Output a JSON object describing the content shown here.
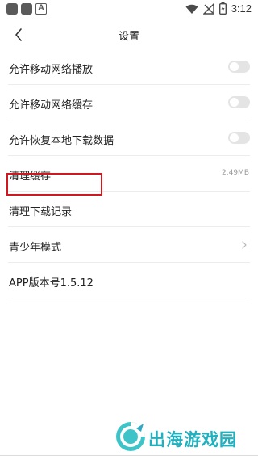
{
  "status_bar": {
    "time": "3:12",
    "icons": [
      "notification-square-icon",
      "notification-square-icon",
      "a-letter-icon",
      "wifi-icon",
      "no-signal-icon",
      "battery-charging-icon"
    ]
  },
  "header": {
    "title": "设置",
    "back_icon": "chevron-left-icon"
  },
  "settings": {
    "items": [
      {
        "label": "允许移动网络播放",
        "control": "toggle",
        "enabled": false
      },
      {
        "label": "允许移动网络缓存",
        "control": "toggle",
        "enabled": false
      },
      {
        "label": "允许恢复本地下载数据",
        "control": "toggle",
        "enabled": false
      },
      {
        "label": "清理缓存",
        "value": "2.49MB"
      },
      {
        "label": "清理下载记录",
        "highlighted": true
      },
      {
        "label": "青少年模式",
        "control": "chevron"
      },
      {
        "label": "APP版本号1.5.12"
      }
    ]
  },
  "annotation": {
    "color": "#d0181f"
  },
  "watermark": {
    "text": "出海游戏园",
    "color": "#1fb1c0"
  }
}
